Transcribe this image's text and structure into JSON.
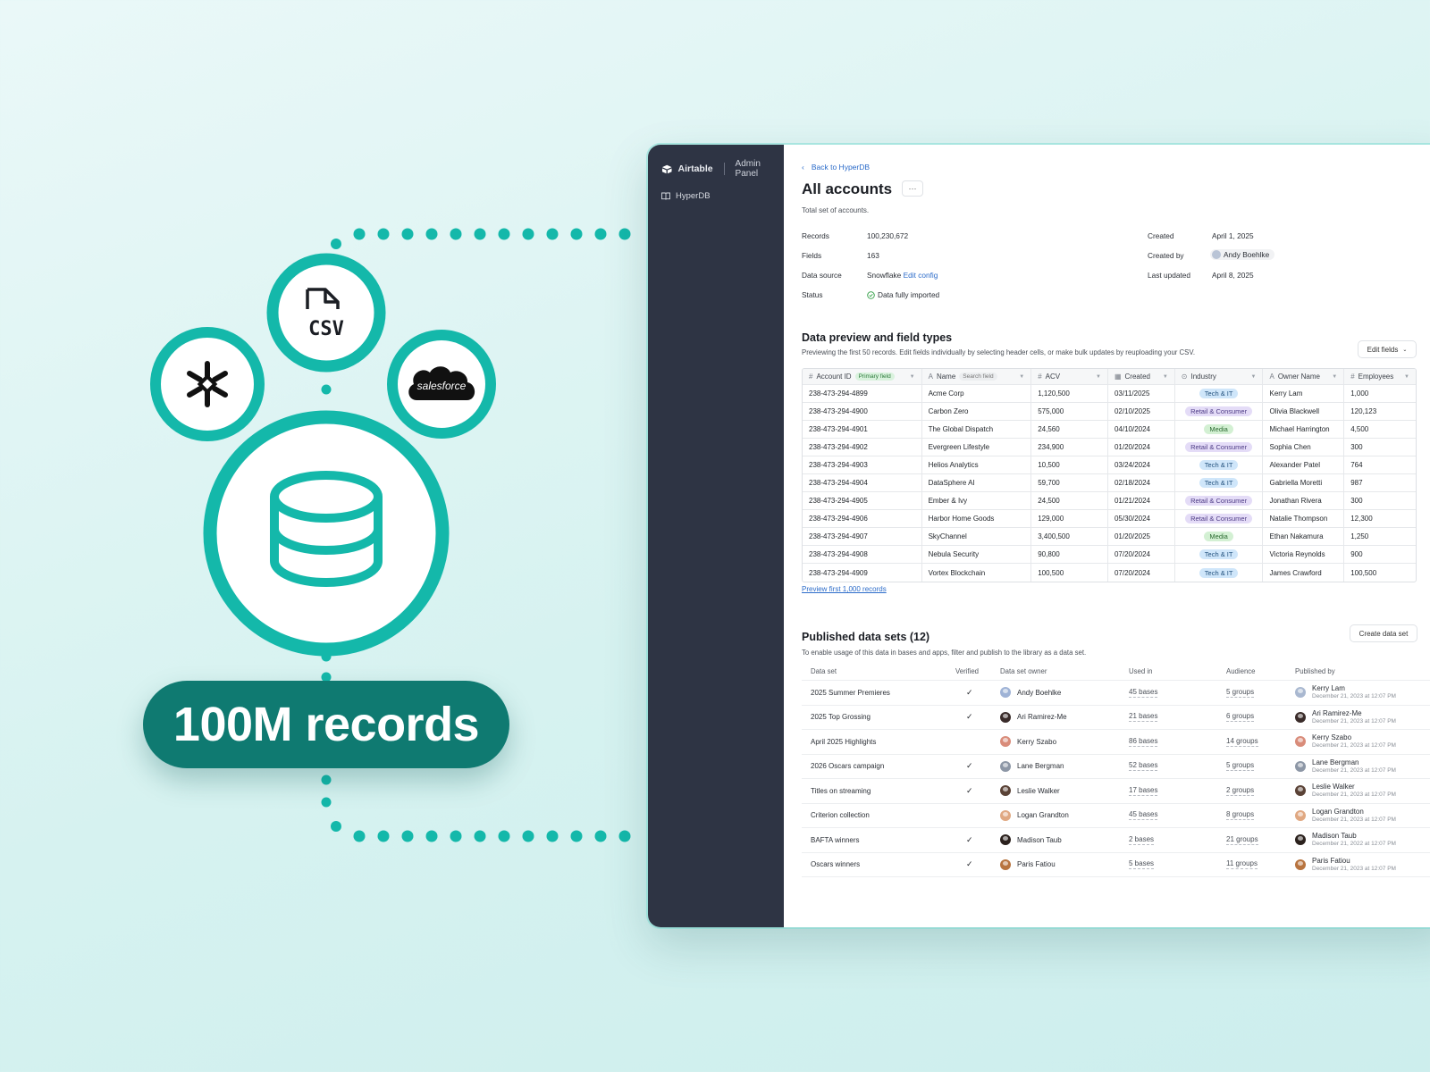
{
  "illustration": {
    "badge_label": "100M records",
    "icons": [
      "csv-file-icon",
      "snowflake-logo-icon",
      "salesforce-logo-icon",
      "database-icon"
    ],
    "salesforce_text": "salesforce",
    "csv_text": "CSV",
    "accent_color": "#14b8aa",
    "badge_color": "#0f7a71"
  },
  "sidebar": {
    "brand": "Airtable",
    "subtitle": "Admin Panel",
    "items": [
      {
        "label": "HyperDB",
        "icon": "book-icon"
      }
    ]
  },
  "header": {
    "back_label": "Back to HyperDB",
    "title": "All accounts",
    "more_label": "···",
    "description": "Total set of accounts."
  },
  "meta": {
    "records_label": "Records",
    "records_value": "100,230,672",
    "fields_label": "Fields",
    "fields_value": "163",
    "source_label": "Data source",
    "source_value": "Snowflake",
    "source_link": "Edit config",
    "status_label": "Status",
    "status_value": "Data fully imported",
    "created_label": "Created",
    "created_value": "April 1, 2025",
    "created_by_label": "Created by",
    "created_by_value": "Andy Boehlke",
    "updated_label": "Last updated",
    "updated_value": "April 8, 2025"
  },
  "preview": {
    "title": "Data preview and field types",
    "description": "Previewing the first 50 records.  Edit fields individually by selecting header cells, or make bulk updates by reuploading your CSV.",
    "edit_fields_label": "Edit fields",
    "primary_tag": "Primary field",
    "search_tag": "Search field",
    "columns": [
      "Account ID",
      "Name",
      "ACV",
      "Created",
      "Industry",
      "Owner Name",
      "Employees"
    ],
    "rows": [
      [
        "238-473-294-4899",
        "Acme Corp",
        "1,120,500",
        "03/11/2025",
        "Tech & IT",
        "Kerry Lam",
        "1,000"
      ],
      [
        "238-473-294-4900",
        "Carbon Zero",
        "575,000",
        "02/10/2025",
        "Retail & Consumer",
        "Olivia Blackwell",
        "120,123"
      ],
      [
        "238-473-294-4901",
        "The Global Dispatch",
        "24,560",
        "04/10/2024",
        "Media",
        "Michael Harrington",
        "4,500"
      ],
      [
        "238-473-294-4902",
        "Evergreen Lifestyle",
        "234,900",
        "01/20/2024",
        "Retail & Consumer",
        "Sophia Chen",
        "300"
      ],
      [
        "238-473-294-4903",
        "Helios Analytics",
        "10,500",
        "03/24/2024",
        "Tech & IT",
        "Alexander Patel",
        "764"
      ],
      [
        "238-473-294-4904",
        "DataSphere AI",
        "59,700",
        "02/18/2024",
        "Tech & IT",
        "Gabriella Moretti",
        "987"
      ],
      [
        "238-473-294-4905",
        "Ember & Ivy",
        "24,500",
        "01/21/2024",
        "Retail & Consumer",
        "Jonathan Rivera",
        "300"
      ],
      [
        "238-473-294-4906",
        "Harbor Home Goods",
        "129,000",
        "05/30/2024",
        "Retail & Consumer",
        "Natalie Thompson",
        "12,300"
      ],
      [
        "238-473-294-4907",
        "SkyChannel",
        "3,400,500",
        "01/20/2025",
        "Media",
        "Ethan Nakamura",
        "1,250"
      ],
      [
        "238-473-294-4908",
        "Nebula Security",
        "90,800",
        "07/20/2024",
        "Tech & IT",
        "Victoria Reynolds",
        "900"
      ],
      [
        "238-473-294-4909",
        "Vortex Blockchain",
        "100,500",
        "07/20/2024",
        "Tech & IT",
        "James Crawford",
        "100,500"
      ]
    ],
    "preview_link": "Preview first 1,000 records"
  },
  "published": {
    "title": "Published data sets (12)",
    "description": "To enable usage of this data in bases and apps, filter and publish to the library as a data set.",
    "create_label": "Create data set",
    "columns": [
      "Data set",
      "Verified",
      "Data set owner",
      "Used in",
      "Audience",
      "Published by"
    ],
    "rows": [
      {
        "name": "2025 Summer Premieres",
        "verified": "✓",
        "owner": "Andy Boehlke",
        "used": "45 bases",
        "audience": "5 groups",
        "pub_name": "Kerry Lam",
        "pub_date": "December 21, 2023 at 12:07 PM",
        "av": "#9fb3d6",
        "pav": "#a9b8d0"
      },
      {
        "name": "2025 Top Grossing",
        "verified": "✓",
        "owner": "Ari Ramirez-Me",
        "used": "21 bases",
        "audience": "6 groups",
        "pub_name": "Ari Ramirez-Me",
        "pub_date": "December 21, 2023 at 12:07 PM",
        "av": "#3a2c2a",
        "pav": "#3a2c2a"
      },
      {
        "name": "April 2025 Highlights",
        "verified": "",
        "owner": "Kerry Szabo",
        "used": "86 bases",
        "audience": "14 groups",
        "pub_name": "Kerry Szabo",
        "pub_date": "December 21, 2023 at 12:07 PM",
        "av": "#d98c7a",
        "pav": "#d98c7a"
      },
      {
        "name": "2026 Oscars campaign",
        "verified": "✓",
        "owner": "Lane Bergman",
        "used": "52 bases",
        "audience": "5 groups",
        "pub_name": "Lane Bergman",
        "pub_date": "December 21, 2023 at 12:07 PM",
        "av": "#8d97a6",
        "pav": "#8d97a6"
      },
      {
        "name": "Titles on streaming",
        "verified": "✓",
        "owner": "Leslie Walker",
        "used": "17 bases",
        "audience": "2 groups",
        "pub_name": "Leslie Walker",
        "pub_date": "December 21, 2023 at 12:07 PM",
        "av": "#5a4236",
        "pav": "#5a4236"
      },
      {
        "name": "Criterion collection",
        "verified": "",
        "owner": "Logan Grandton",
        "used": "45 bases",
        "audience": "8 groups",
        "pub_name": "Logan Grandton",
        "pub_date": "December 21, 2023 at 12:07 PM",
        "av": "#e0a882",
        "pav": "#e0a882"
      },
      {
        "name": "BAFTA winners",
        "verified": "✓",
        "owner": "Madison Taub",
        "used": "2 bases",
        "audience": "21 groups",
        "pub_name": "Madison Taub",
        "pub_date": "December 21, 2022 at 12:07 PM",
        "av": "#2b211d",
        "pav": "#2b211d"
      },
      {
        "name": "Oscars winners",
        "verified": "✓",
        "owner": "Paris Fatiou",
        "used": "5 bases",
        "audience": "11 groups",
        "pub_name": "Paris Fatiou",
        "pub_date": "December 21, 2023 at 12:07 PM",
        "av": "#b8743f",
        "pav": "#b8743f"
      }
    ]
  }
}
